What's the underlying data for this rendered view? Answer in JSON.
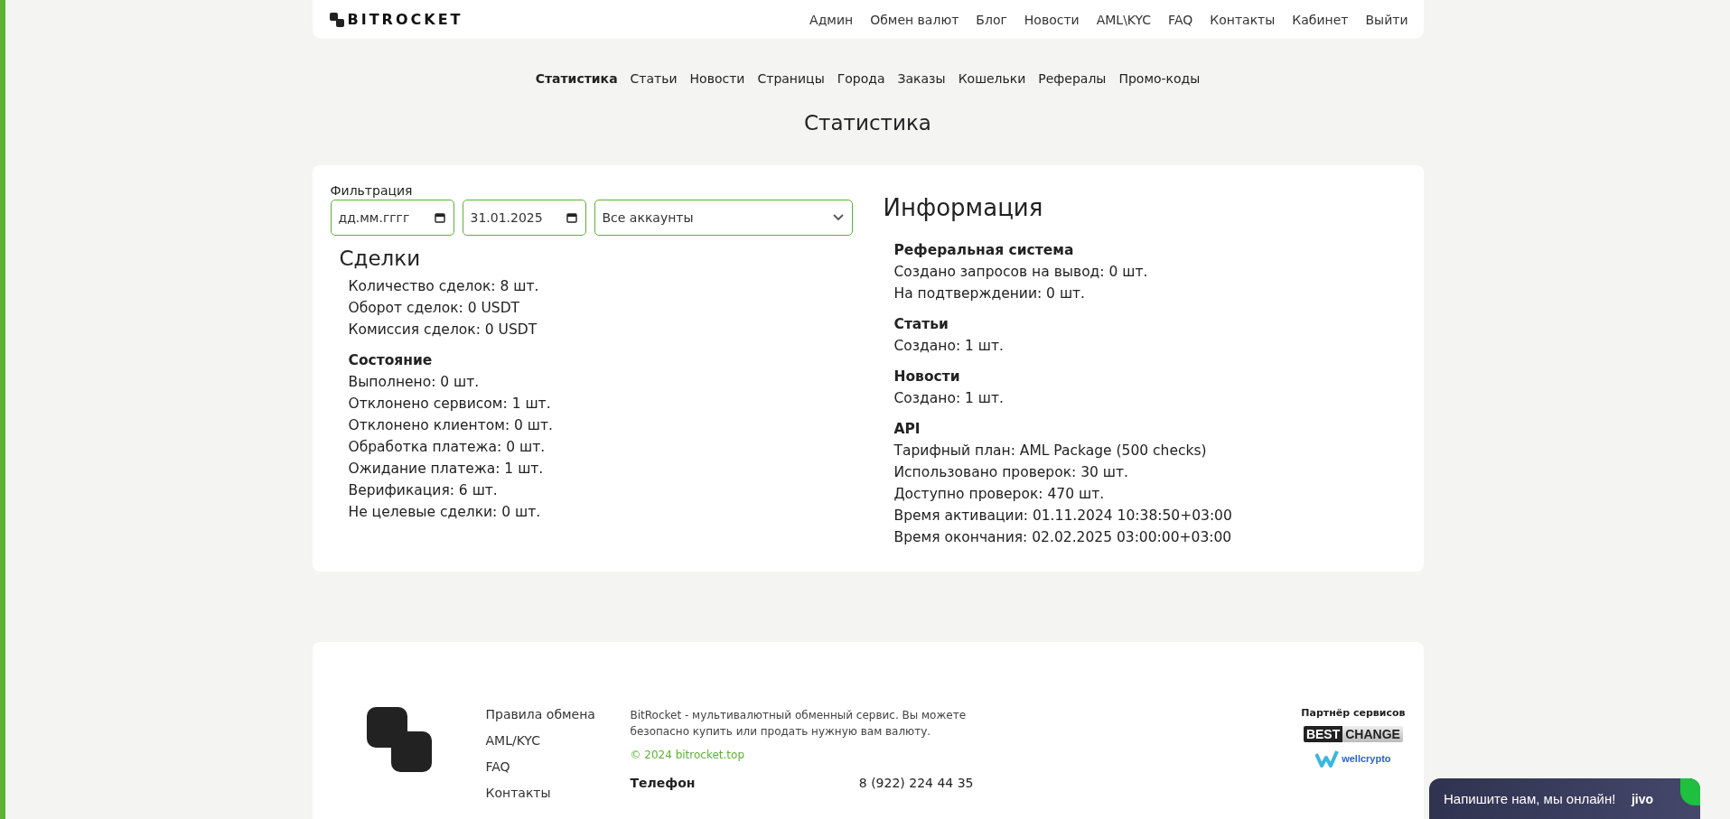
{
  "header": {
    "logo": "BITROCKET",
    "menu": [
      "Админ",
      "Обмен валют",
      "Блог",
      "Новости",
      "AML\\KYC",
      "FAQ",
      "Контакты",
      "Кабинет",
      "Выйти"
    ]
  },
  "admin_tabs": [
    {
      "label": "Статистика",
      "selected": true
    },
    {
      "label": "Статьи",
      "selected": false
    },
    {
      "label": "Новости",
      "selected": false
    },
    {
      "label": "Страницы",
      "selected": false
    },
    {
      "label": "Города",
      "selected": false
    },
    {
      "label": "Заказы",
      "selected": false
    },
    {
      "label": "Кошельки",
      "selected": false
    },
    {
      "label": "Рефералы",
      "selected": false
    },
    {
      "label": "Промо-коды",
      "selected": false
    }
  ],
  "page_title": "Статистика",
  "filter": {
    "label": "Фильтрация",
    "date_from": {
      "placeholder": "дд.мм.гггг"
    },
    "date_to": {
      "value": "31.01.2025"
    },
    "account": {
      "value": "Все аккаунты"
    }
  },
  "deals": {
    "title": "Сделки",
    "lines": [
      "Количество сделок: 8 шт.",
      "Оборот сделок: 0 USDT",
      "Комиссия сделок: 0 USDT"
    ],
    "sections": [
      {
        "title": "Состояние",
        "lines": [
          "Выполнено: 0 шт.",
          "Отклонено сервисом: 1 шт.",
          "Отклонено клиентом: 0 шт.",
          "Обработка платежа: 0 шт.",
          "Ожидание платежа: 1 шт.",
          "Верификация: 6 шт.",
          "Не целевые сделки: 0 шт."
        ]
      }
    ]
  },
  "info": {
    "title": "Информация",
    "sections": [
      {
        "title": "Реферальная система",
        "lines": [
          "Создано запросов на вывод: 0 шт.",
          "На подтверждении: 0 шт."
        ]
      },
      {
        "title": "Статьи",
        "lines": [
          "Создано: 1 шт."
        ]
      },
      {
        "title": "Новости",
        "lines": [
          "Создано: 1 шт."
        ]
      },
      {
        "title": "API",
        "lines": [
          "Тарифный план: AML Package (500 checks)",
          "Использовано проверок: 30 шт.",
          "Доступно проверок: 470 шт.",
          "Время активации: 01.11.2024 10:38:50+03:00",
          "Время окончания: 02.02.2025 03:00:00+03:00"
        ]
      }
    ]
  },
  "footer": {
    "links": [
      "Правила обмена",
      "AML/KYC",
      "FAQ",
      "Контакты"
    ],
    "about": "BitRocket - мультивалютный обменный сервис. Вы можете безопасно купить или продать нужную вам валюту.",
    "copyright": "© 2024 bitrocket.top",
    "phone_label": "Телефон",
    "phone": "8 (922) 224 44 35",
    "partners": {
      "title": "Партнёр сервисов",
      "bestchange": [
        "BEST",
        "CHANGE"
      ],
      "wellcrypto": "wellcrypto"
    }
  },
  "chat": {
    "text": "Напишите нам, мы онлайн!",
    "brand": "jivo"
  }
}
